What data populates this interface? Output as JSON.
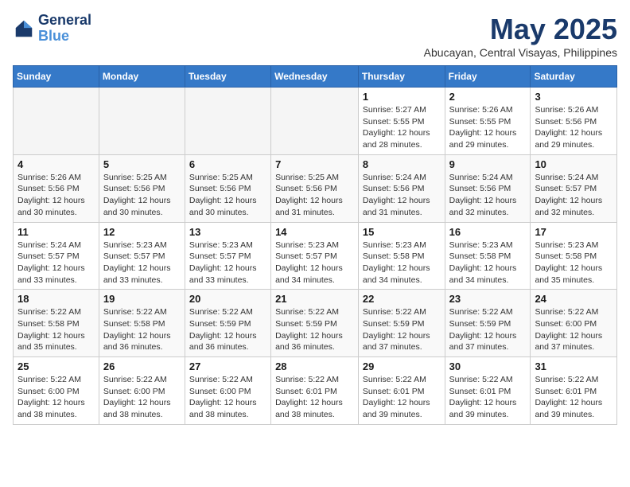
{
  "logo": {
    "line1": "General",
    "line2": "Blue"
  },
  "title": "May 2025",
  "location": "Abucayan, Central Visayas, Philippines",
  "days_header": [
    "Sunday",
    "Monday",
    "Tuesday",
    "Wednesday",
    "Thursday",
    "Friday",
    "Saturday"
  ],
  "weeks": [
    [
      {
        "num": "",
        "info": "",
        "empty": true
      },
      {
        "num": "",
        "info": "",
        "empty": true
      },
      {
        "num": "",
        "info": "",
        "empty": true
      },
      {
        "num": "",
        "info": "",
        "empty": true
      },
      {
        "num": "1",
        "info": "Sunrise: 5:27 AM\nSunset: 5:55 PM\nDaylight: 12 hours\nand 28 minutes.",
        "empty": false
      },
      {
        "num": "2",
        "info": "Sunrise: 5:26 AM\nSunset: 5:55 PM\nDaylight: 12 hours\nand 29 minutes.",
        "empty": false
      },
      {
        "num": "3",
        "info": "Sunrise: 5:26 AM\nSunset: 5:56 PM\nDaylight: 12 hours\nand 29 minutes.",
        "empty": false
      }
    ],
    [
      {
        "num": "4",
        "info": "Sunrise: 5:26 AM\nSunset: 5:56 PM\nDaylight: 12 hours\nand 30 minutes.",
        "empty": false
      },
      {
        "num": "5",
        "info": "Sunrise: 5:25 AM\nSunset: 5:56 PM\nDaylight: 12 hours\nand 30 minutes.",
        "empty": false
      },
      {
        "num": "6",
        "info": "Sunrise: 5:25 AM\nSunset: 5:56 PM\nDaylight: 12 hours\nand 30 minutes.",
        "empty": false
      },
      {
        "num": "7",
        "info": "Sunrise: 5:25 AM\nSunset: 5:56 PM\nDaylight: 12 hours\nand 31 minutes.",
        "empty": false
      },
      {
        "num": "8",
        "info": "Sunrise: 5:24 AM\nSunset: 5:56 PM\nDaylight: 12 hours\nand 31 minutes.",
        "empty": false
      },
      {
        "num": "9",
        "info": "Sunrise: 5:24 AM\nSunset: 5:56 PM\nDaylight: 12 hours\nand 32 minutes.",
        "empty": false
      },
      {
        "num": "10",
        "info": "Sunrise: 5:24 AM\nSunset: 5:57 PM\nDaylight: 12 hours\nand 32 minutes.",
        "empty": false
      }
    ],
    [
      {
        "num": "11",
        "info": "Sunrise: 5:24 AM\nSunset: 5:57 PM\nDaylight: 12 hours\nand 33 minutes.",
        "empty": false
      },
      {
        "num": "12",
        "info": "Sunrise: 5:23 AM\nSunset: 5:57 PM\nDaylight: 12 hours\nand 33 minutes.",
        "empty": false
      },
      {
        "num": "13",
        "info": "Sunrise: 5:23 AM\nSunset: 5:57 PM\nDaylight: 12 hours\nand 33 minutes.",
        "empty": false
      },
      {
        "num": "14",
        "info": "Sunrise: 5:23 AM\nSunset: 5:57 PM\nDaylight: 12 hours\nand 34 minutes.",
        "empty": false
      },
      {
        "num": "15",
        "info": "Sunrise: 5:23 AM\nSunset: 5:58 PM\nDaylight: 12 hours\nand 34 minutes.",
        "empty": false
      },
      {
        "num": "16",
        "info": "Sunrise: 5:23 AM\nSunset: 5:58 PM\nDaylight: 12 hours\nand 34 minutes.",
        "empty": false
      },
      {
        "num": "17",
        "info": "Sunrise: 5:23 AM\nSunset: 5:58 PM\nDaylight: 12 hours\nand 35 minutes.",
        "empty": false
      }
    ],
    [
      {
        "num": "18",
        "info": "Sunrise: 5:22 AM\nSunset: 5:58 PM\nDaylight: 12 hours\nand 35 minutes.",
        "empty": false
      },
      {
        "num": "19",
        "info": "Sunrise: 5:22 AM\nSunset: 5:58 PM\nDaylight: 12 hours\nand 36 minutes.",
        "empty": false
      },
      {
        "num": "20",
        "info": "Sunrise: 5:22 AM\nSunset: 5:59 PM\nDaylight: 12 hours\nand 36 minutes.",
        "empty": false
      },
      {
        "num": "21",
        "info": "Sunrise: 5:22 AM\nSunset: 5:59 PM\nDaylight: 12 hours\nand 36 minutes.",
        "empty": false
      },
      {
        "num": "22",
        "info": "Sunrise: 5:22 AM\nSunset: 5:59 PM\nDaylight: 12 hours\nand 37 minutes.",
        "empty": false
      },
      {
        "num": "23",
        "info": "Sunrise: 5:22 AM\nSunset: 5:59 PM\nDaylight: 12 hours\nand 37 minutes.",
        "empty": false
      },
      {
        "num": "24",
        "info": "Sunrise: 5:22 AM\nSunset: 6:00 PM\nDaylight: 12 hours\nand 37 minutes.",
        "empty": false
      }
    ],
    [
      {
        "num": "25",
        "info": "Sunrise: 5:22 AM\nSunset: 6:00 PM\nDaylight: 12 hours\nand 38 minutes.",
        "empty": false
      },
      {
        "num": "26",
        "info": "Sunrise: 5:22 AM\nSunset: 6:00 PM\nDaylight: 12 hours\nand 38 minutes.",
        "empty": false
      },
      {
        "num": "27",
        "info": "Sunrise: 5:22 AM\nSunset: 6:00 PM\nDaylight: 12 hours\nand 38 minutes.",
        "empty": false
      },
      {
        "num": "28",
        "info": "Sunrise: 5:22 AM\nSunset: 6:01 PM\nDaylight: 12 hours\nand 38 minutes.",
        "empty": false
      },
      {
        "num": "29",
        "info": "Sunrise: 5:22 AM\nSunset: 6:01 PM\nDaylight: 12 hours\nand 39 minutes.",
        "empty": false
      },
      {
        "num": "30",
        "info": "Sunrise: 5:22 AM\nSunset: 6:01 PM\nDaylight: 12 hours\nand 39 minutes.",
        "empty": false
      },
      {
        "num": "31",
        "info": "Sunrise: 5:22 AM\nSunset: 6:01 PM\nDaylight: 12 hours\nand 39 minutes.",
        "empty": false
      }
    ]
  ]
}
